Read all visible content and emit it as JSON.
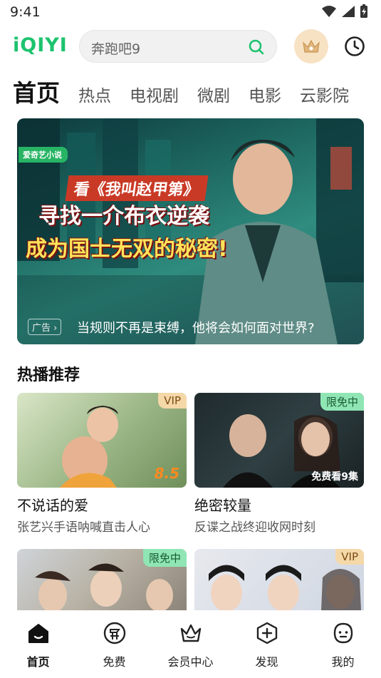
{
  "status": {
    "time": "9:41"
  },
  "header": {
    "logo": "iQIYI",
    "search_placeholder": "奔跑吧9"
  },
  "tabs": [
    {
      "label": "首页",
      "active": true
    },
    {
      "label": "热点"
    },
    {
      "label": "电视剧"
    },
    {
      "label": "微剧"
    },
    {
      "label": "电影"
    },
    {
      "label": "云影院"
    }
  ],
  "banner": {
    "badge": "爱奇艺小说",
    "line1": "看《我叫赵甲第》",
    "line2": "寻找一介布衣逆袭",
    "line3": "成为国士无双的秘密!",
    "ad_label": "广告",
    "caption": "当规则不再是束缚，他将会如何面对世界?"
  },
  "section": {
    "title": "热播推荐"
  },
  "cards": [
    {
      "title": "不说话的爱",
      "subtitle": "张艺兴手语呐喊直击人心",
      "tag": "VIP",
      "score": "8.5"
    },
    {
      "title": "绝密较量",
      "subtitle": "反谍之战终迎收网时刻",
      "tag": "限免中",
      "episodes": "免费看9集"
    },
    {
      "tag": "限免中"
    },
    {
      "tag": "VIP"
    }
  ],
  "bottom_nav": [
    {
      "label": "首页",
      "icon": "home-icon",
      "active": true
    },
    {
      "label": "免费",
      "icon": "free-icon"
    },
    {
      "label": "会员中心",
      "icon": "crown-icon"
    },
    {
      "label": "发现",
      "icon": "discover-icon"
    },
    {
      "label": "我的",
      "icon": "profile-icon"
    }
  ],
  "colors": {
    "brand": "#1cc36e",
    "vip_tag": "#f5d8a8",
    "free_tag": "#8fe6b4"
  }
}
